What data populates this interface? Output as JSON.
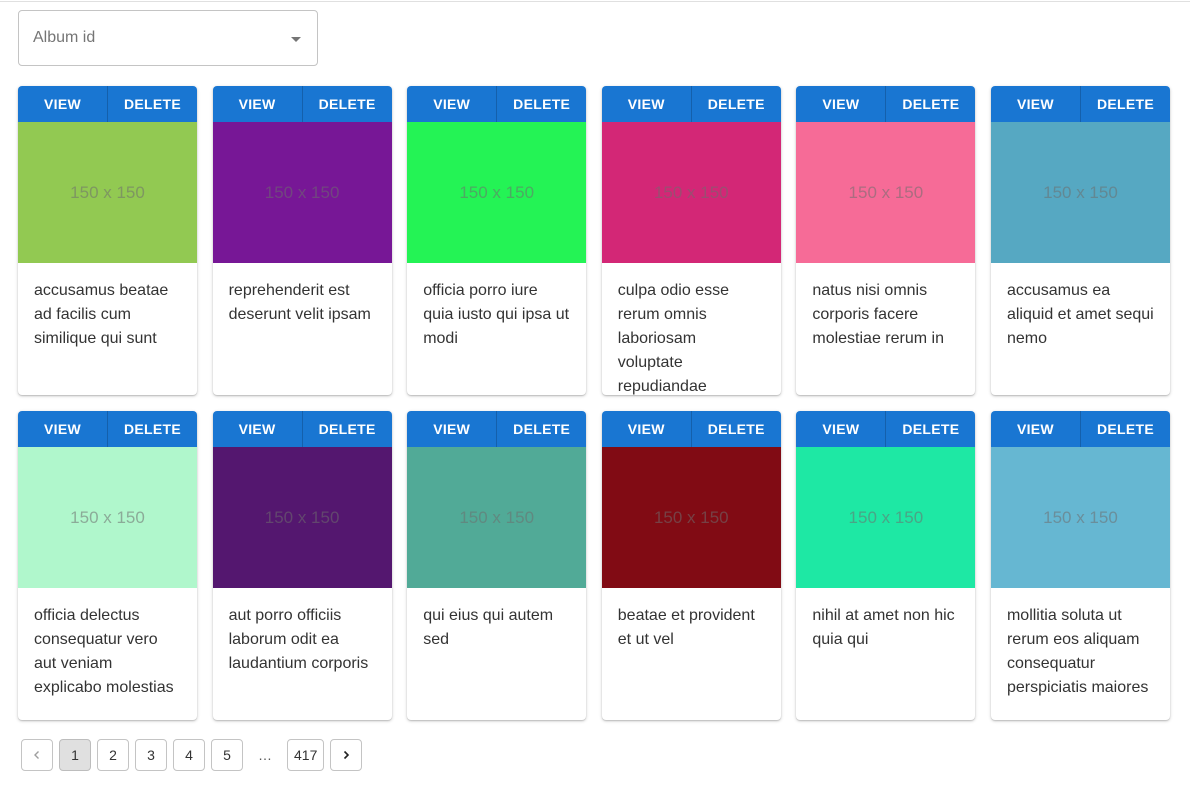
{
  "filter": {
    "placeholder": "Album id"
  },
  "card_actions": {
    "view_label": "VIEW",
    "delete_label": "DELETE"
  },
  "photos": [
    {
      "color": "#92c952",
      "thumb_text": "150 x 150",
      "title": "accusamus beatae ad facilis cum similique qui sunt"
    },
    {
      "color": "#771796",
      "thumb_text": "150 x 150",
      "title": "reprehenderit est deserunt velit ipsam"
    },
    {
      "color": "#24f355",
      "thumb_text": "150 x 150",
      "title": "officia porro iure quia iusto qui ipsa ut modi"
    },
    {
      "color": "#d32776",
      "thumb_text": "150 x 150",
      "title": "culpa odio esse rerum omnis laboriosam voluptate repudiandae"
    },
    {
      "color": "#f66b97",
      "thumb_text": "150 x 150",
      "title": "natus nisi omnis corporis facere molestiae rerum in"
    },
    {
      "color": "#56a8c2",
      "thumb_text": "150 x 150",
      "title": "accusamus ea aliquid et amet sequi nemo"
    },
    {
      "color": "#b0f7cc",
      "thumb_text": "150 x 150",
      "title": "officia delectus consequatur vero aut veniam explicabo molestias"
    },
    {
      "color": "#54176f",
      "thumb_text": "150 x 150",
      "title": "aut porro officiis laborum odit ea laudantium corporis"
    },
    {
      "color": "#51aa97",
      "thumb_text": "150 x 150",
      "title": "qui eius qui autem sed"
    },
    {
      "color": "#810b14",
      "thumb_text": "150 x 150",
      "title": "beatae et provident et ut vel"
    },
    {
      "color": "#1ee8a4",
      "thumb_text": "150 x 150",
      "title": "nihil at amet non hic quia qui"
    },
    {
      "color": "#66b7d2",
      "thumb_text": "150 x 150",
      "title": "mollitia soluta ut rerum eos aliquam consequatur perspiciatis maiores"
    }
  ],
  "pagination": {
    "prev_icon": "chevron-left-icon",
    "next_icon": "chevron-right-icon",
    "pages": [
      "1",
      "2",
      "3",
      "4",
      "5",
      "…",
      "417"
    ],
    "current": "1"
  }
}
